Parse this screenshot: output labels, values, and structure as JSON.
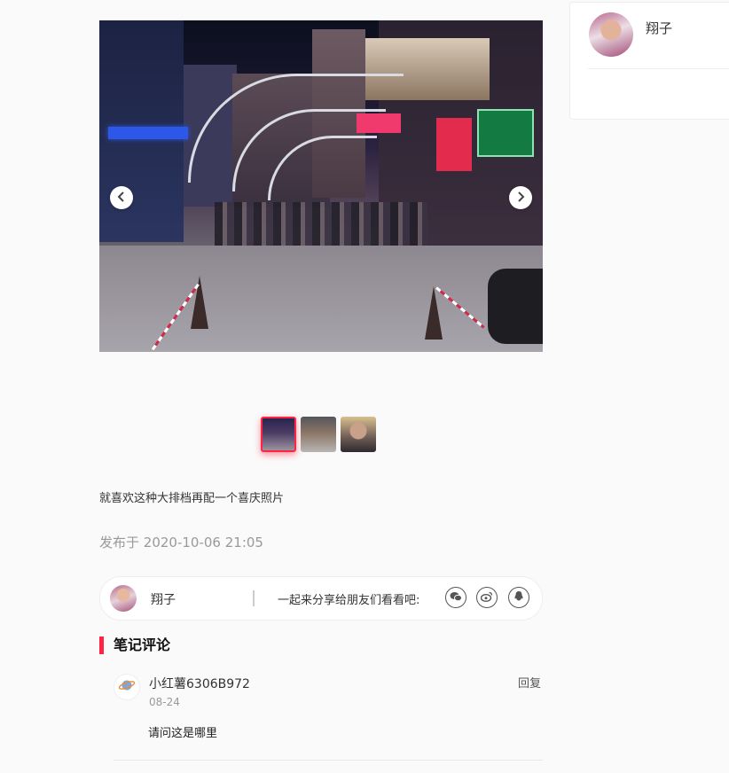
{
  "carousel": {
    "prev_icon": "chevron-left-icon",
    "next_icon": "chevron-right-icon",
    "slide_count": 3,
    "active_index": 0
  },
  "post": {
    "description": "就喜欢这种大排档再配一个喜庆照片",
    "published_label": "发布于",
    "published_time": "2020-10-06 21:05"
  },
  "share": {
    "author_name": "翔子",
    "prompt": "一起来分享给朋友们看看吧:",
    "icons": [
      "wechat-icon",
      "weibo-icon",
      "qq-icon"
    ]
  },
  "comments": {
    "title": "笔记评论",
    "items": [
      {
        "user": "小红薯6306B972",
        "date": "08-24",
        "text": "请问这是哪里",
        "reply_label": "回复",
        "avatar_icon": "planet-icon"
      }
    ]
  },
  "author_card": {
    "name": "翔子"
  },
  "colors": {
    "accent": "#ff2442",
    "muted_text": "#999999",
    "page_bg": "#fafafa"
  }
}
